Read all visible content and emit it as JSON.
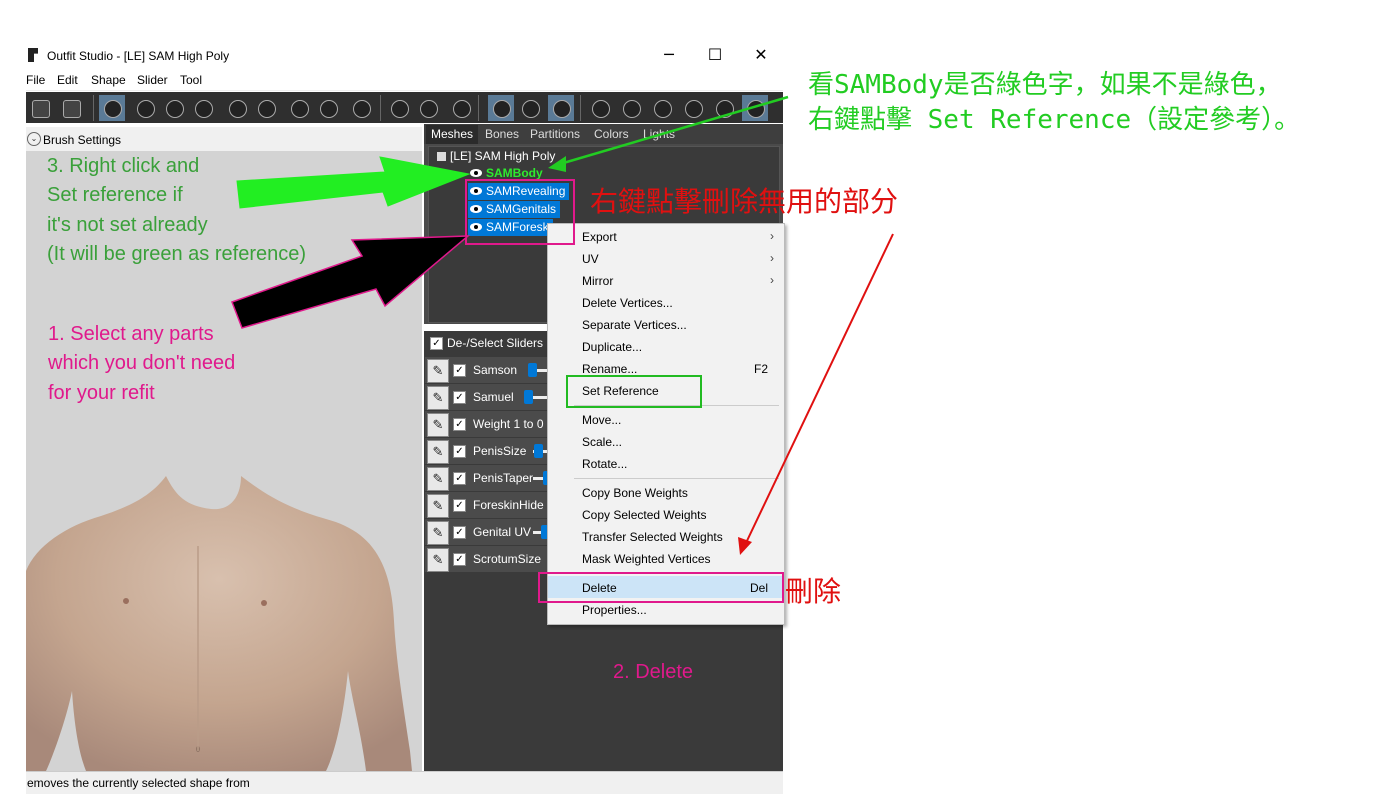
{
  "window": {
    "title": "Outfit Studio - [LE] SAM High Poly",
    "minimize": "─",
    "maximize": "☐",
    "close": "✕"
  },
  "menu": [
    "File",
    "Edit",
    "Shape",
    "Slider",
    "Tool"
  ],
  "toolbar": {
    "icons": [
      "brush-1-icon",
      "brush-2-icon",
      "select-brush-icon",
      "mask-brush-icon",
      "inflate-brush-icon",
      "deflate-brush-icon",
      "move-brush-icon",
      "smooth-brush-icon",
      "weight-brush-icon",
      "color-brush-icon",
      "alpha-brush-icon",
      "transform-tool-icon",
      "pivot-tool-icon",
      "pencil-tool-icon",
      "symmetry-x-icon",
      "weld-icon",
      "view-points-icon",
      "view-front-icon",
      "view-back-icon",
      "view-left-icon",
      "view-right-icon",
      "shading-icon",
      "cube-icon"
    ]
  },
  "brush_panel": {
    "label": "Brush Settings"
  },
  "tabs": [
    "Meshes",
    "Bones",
    "Partitions",
    "Colors",
    "Lights"
  ],
  "mesh_tree": {
    "root": "[LE] SAM High Poly",
    "meshes": [
      {
        "name": "SAMBody",
        "reference": true,
        "selected": false
      },
      {
        "name": "SAMRevealing",
        "reference": false,
        "selected": true
      },
      {
        "name": "SAMGenitals",
        "reference": false,
        "selected": true
      },
      {
        "name": "SAMForesk",
        "reference": false,
        "selected": true
      }
    ]
  },
  "sliders": {
    "header": "De-/Select Sliders",
    "rows": [
      {
        "label": "Samson"
      },
      {
        "label": "Samuel"
      },
      {
        "label": "Weight 1 to 0"
      },
      {
        "label": "PenisSize"
      },
      {
        "label": "PenisTaper"
      },
      {
        "label": "ForeskinHide"
      },
      {
        "label": "Genital UV"
      },
      {
        "label": "ScrotumSize"
      }
    ]
  },
  "context_menu": {
    "export": "Export",
    "uv": "UV",
    "mirror": "Mirror",
    "delete_vertices": "Delete Vertices...",
    "separate_vertices": "Separate Vertices...",
    "duplicate": "Duplicate...",
    "rename": "Rename...",
    "rename_shortcut": "F2",
    "set_reference": "Set Reference",
    "move": "Move...",
    "scale": "Scale...",
    "rotate": "Rotate...",
    "copy_bone_weights": "Copy Bone Weights",
    "copy_selected_weights": "Copy Selected Weights",
    "transfer_selected_weights": "Transfer Selected Weights",
    "mask_weighted_vertices": "Mask Weighted Vertices",
    "delete": "Delete",
    "delete_shortcut": "Del",
    "properties": "Properties..."
  },
  "status_text": "emoves the currently selected shape from",
  "annotations": {
    "step3": [
      "3. Right click and",
      "Set reference if",
      "it's not set already",
      "(It will be green as reference)"
    ],
    "step1": [
      "1. Select any parts",
      "which you don't need",
      "for your refit"
    ],
    "step2": "2. Delete",
    "zh_reference": [
      "看SAMBody是否綠色字，如果不是綠色，",
      "右鍵點擊 Set Reference（設定參考）。"
    ],
    "zh_remove": "右鍵點擊刪除無用的部分",
    "zh_delete": "刪除"
  },
  "colors": {
    "annotation_green": "#3aa03a",
    "annotation_pink": "#e0198c",
    "annotation_red": "#e01010",
    "arrow_green": "#22ee22",
    "reference_text": "#2eea2e",
    "selection_blue": "#0078d7",
    "viewport_bg": "#d3d3d3",
    "panel_dark": "#3a3a3a"
  }
}
